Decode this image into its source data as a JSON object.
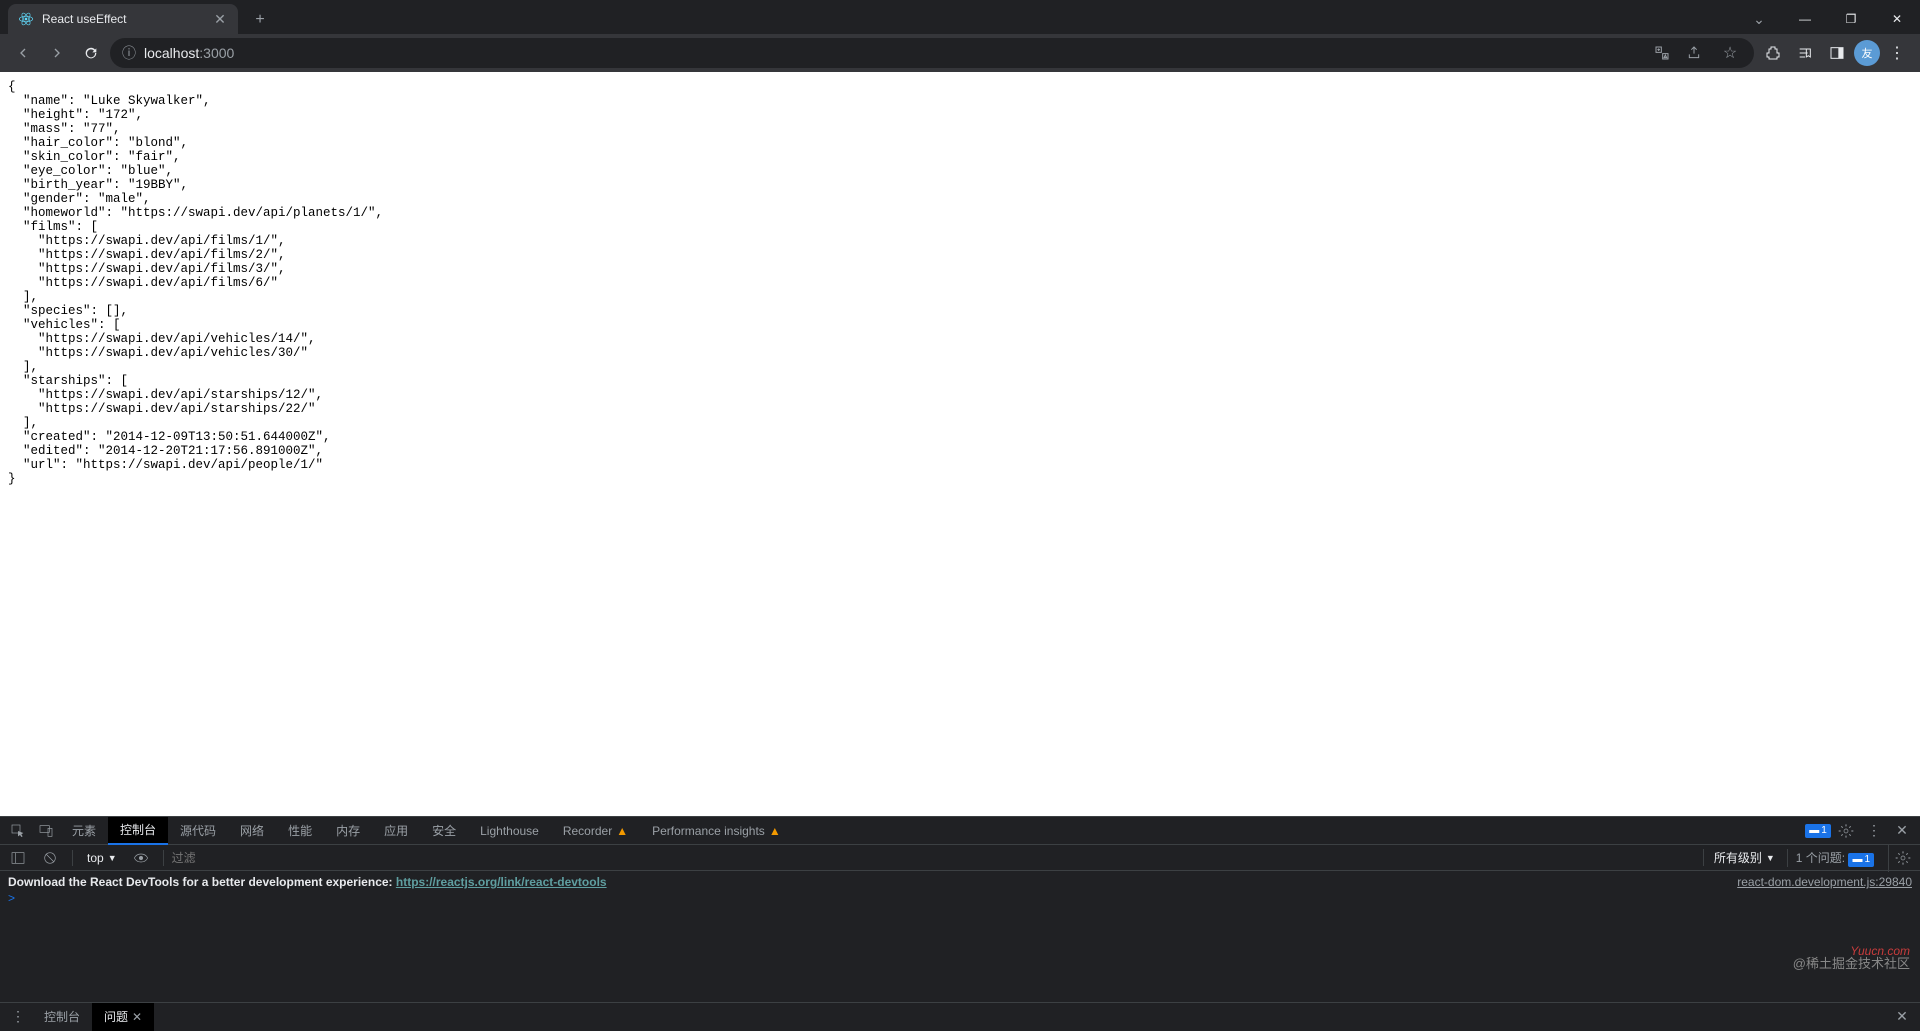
{
  "browser": {
    "tab_title": "React useEffect",
    "url_host": "localhost",
    "url_port": ":3000",
    "win": {
      "minimize": "—",
      "maximize": "❐",
      "close": "✕",
      "chevron": "⌄"
    }
  },
  "page_json": "{\n  \"name\": \"Luke Skywalker\",\n  \"height\": \"172\",\n  \"mass\": \"77\",\n  \"hair_color\": \"blond\",\n  \"skin_color\": \"fair\",\n  \"eye_color\": \"blue\",\n  \"birth_year\": \"19BBY\",\n  \"gender\": \"male\",\n  \"homeworld\": \"https://swapi.dev/api/planets/1/\",\n  \"films\": [\n    \"https://swapi.dev/api/films/1/\",\n    \"https://swapi.dev/api/films/2/\",\n    \"https://swapi.dev/api/films/3/\",\n    \"https://swapi.dev/api/films/6/\"\n  ],\n  \"species\": [],\n  \"vehicles\": [\n    \"https://swapi.dev/api/vehicles/14/\",\n    \"https://swapi.dev/api/vehicles/30/\"\n  ],\n  \"starships\": [\n    \"https://swapi.dev/api/starships/12/\",\n    \"https://swapi.dev/api/starships/22/\"\n  ],\n  \"created\": \"2014-12-09T13:50:51.644000Z\",\n  \"edited\": \"2014-12-20T21:17:56.891000Z\",\n  \"url\": \"https://swapi.dev/api/people/1/\"\n}",
  "devtools": {
    "tabs": [
      "元素",
      "控制台",
      "源代码",
      "网络",
      "性能",
      "内存",
      "应用",
      "安全",
      "Lighthouse",
      "Recorder",
      "Performance insights"
    ],
    "active_tab": "控制台",
    "issues_badge": "1",
    "toolbar": {
      "context": "top",
      "filter_placeholder": "过滤",
      "levels": "所有级别",
      "issues_label": "1 个问题:",
      "issues_count": "1"
    },
    "console": {
      "msg_prefix": "Download the React DevTools for a better development experience: ",
      "msg_link": "https://reactjs.org/link/react-devtools",
      "msg_source": "react-dom.development.js:29840",
      "prompt": ">"
    },
    "drawer": {
      "tabs": [
        "控制台",
        "问题"
      ],
      "active": "问题"
    }
  },
  "watermarks": {
    "red": "Yuucn.com",
    "grey": "@稀土掘金技术社区"
  }
}
